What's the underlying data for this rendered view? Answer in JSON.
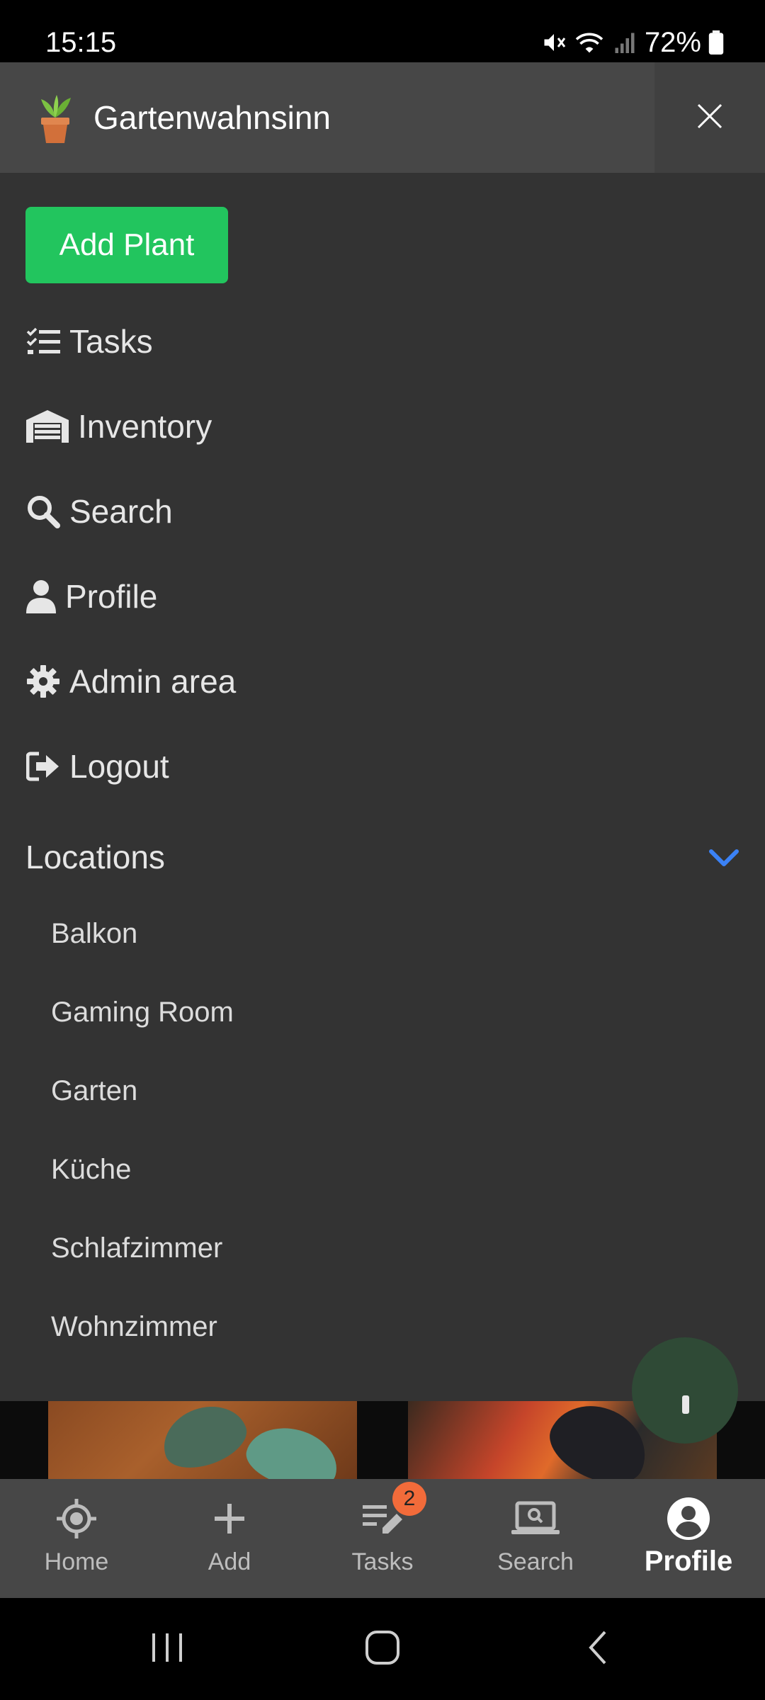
{
  "status_bar": {
    "time": "15:15",
    "battery": "72%",
    "icons": [
      "mute-icon",
      "wifi-icon",
      "signal-icon",
      "battery-icon"
    ]
  },
  "drawer": {
    "title": "Gartenwahnsinn",
    "logo_icon": "potted-plant-icon",
    "close_icon": "close-icon",
    "add_plant_label": "Add Plant",
    "menu": [
      {
        "label": "Tasks",
        "icon": "task-list-icon"
      },
      {
        "label": "Inventory",
        "icon": "warehouse-icon"
      },
      {
        "label": "Search",
        "icon": "search-icon"
      },
      {
        "label": "Profile",
        "icon": "user-icon"
      },
      {
        "label": "Admin area",
        "icon": "gear-icon"
      },
      {
        "label": "Logout",
        "icon": "logout-icon"
      }
    ],
    "locations_label": "Locations",
    "locations_icon": "chevron-down-icon",
    "locations": [
      "Balkon",
      "Gaming Room",
      "Garten",
      "Küche",
      "Schlafzimmer",
      "Wohnzimmer"
    ]
  },
  "bottom_nav": {
    "items": [
      {
        "label": "Home",
        "icon": "crosshair-icon"
      },
      {
        "label": "Add",
        "icon": "plus-icon"
      },
      {
        "label": "Tasks",
        "icon": "edit-list-icon",
        "badge": "2"
      },
      {
        "label": "Search",
        "icon": "laptop-search-icon"
      },
      {
        "label": "Profile",
        "icon": "account-circle-icon",
        "active": true
      }
    ]
  },
  "colors": {
    "accent_green": "#22c55e",
    "drawer_bg": "#333333",
    "header_bg": "#474747",
    "chevron_blue": "#3b82f6",
    "badge_orange": "#f26b3a"
  }
}
